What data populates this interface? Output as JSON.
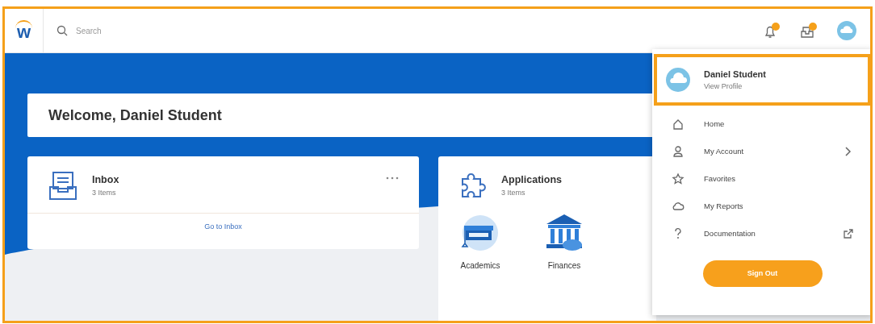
{
  "frame": {
    "highlighted": true
  },
  "logo": {
    "text": "w"
  },
  "search": {
    "placeholder": "Search"
  },
  "header_icons": [
    {
      "kind": "bell",
      "has_badge": true
    },
    {
      "kind": "inbox",
      "has_badge": true
    },
    {
      "kind": "avatar",
      "has_badge": false
    }
  ],
  "welcome": "Welcome, Daniel Student",
  "cards": [
    {
      "kind": "inbox",
      "title": "Inbox",
      "subtitle": "3 Items",
      "footer_link": "Go to Inbox"
    },
    {
      "kind": "applications",
      "title": "Applications",
      "subtitle": "3 Items",
      "apps": [
        {
          "kind": "academics",
          "label": "Academics"
        },
        {
          "kind": "finances",
          "label": "Finances"
        }
      ]
    }
  ],
  "profile_menu": {
    "name": "Daniel Student",
    "link": "View Profile",
    "highlighted": true,
    "items": [
      {
        "kind": "home",
        "label": "Home",
        "has_submenu": false,
        "external": false
      },
      {
        "kind": "account",
        "label": "My Account",
        "has_submenu": true,
        "external": false
      },
      {
        "kind": "star",
        "label": "Favorites",
        "has_submenu": false,
        "external": false
      },
      {
        "kind": "cloud",
        "label": "My Reports",
        "has_submenu": false,
        "external": false
      },
      {
        "kind": "help",
        "label": "Documentation",
        "has_submenu": false,
        "external": true
      }
    ],
    "sign_out": "Sign Out"
  }
}
